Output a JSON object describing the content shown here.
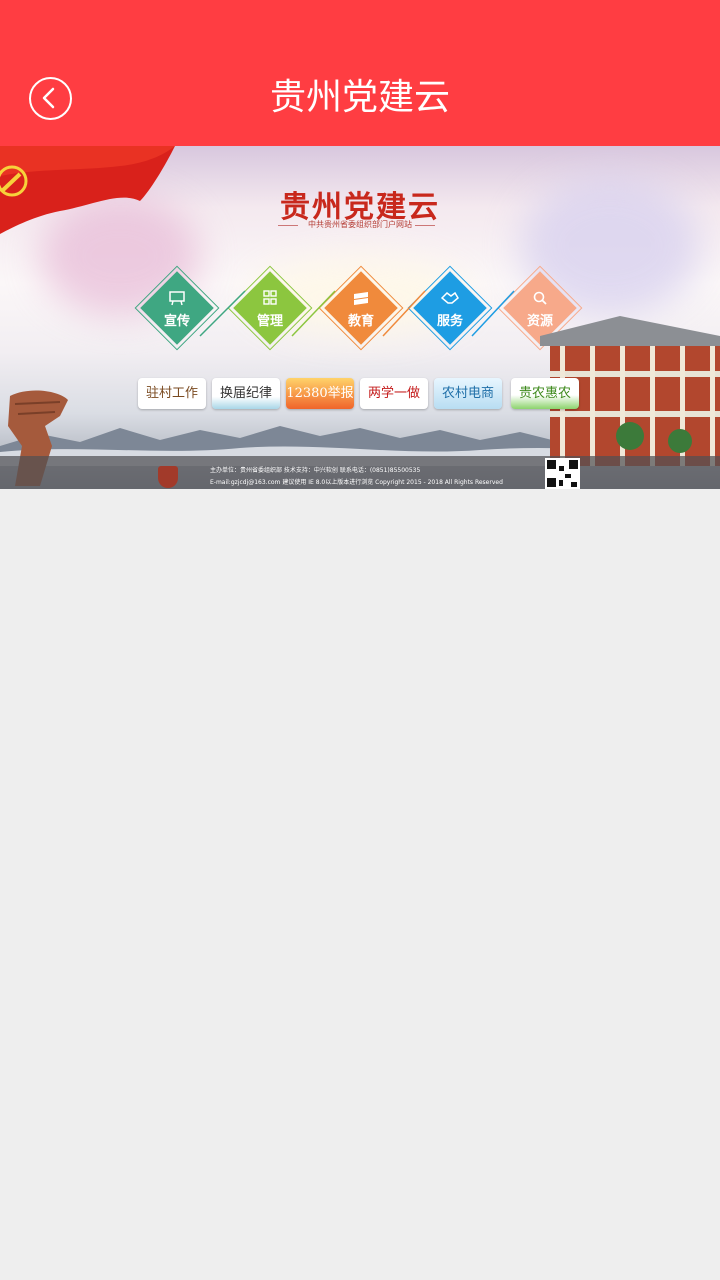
{
  "header": {
    "title": "贵州党建云",
    "back_icon": "back-arrow-icon"
  },
  "banner": {
    "title": "贵州党建云",
    "subtitle": "中共贵州省委组织部门户网站",
    "categories": [
      {
        "label": "宣传",
        "color": "#3fa782",
        "icon": "billboard-icon"
      },
      {
        "label": "管理",
        "color": "#8cc63f",
        "icon": "grid-icon"
      },
      {
        "label": "教育",
        "color": "#f08a3c",
        "icon": "books-icon"
      },
      {
        "label": "服务",
        "color": "#1e9de3",
        "icon": "handshake-icon"
      },
      {
        "label": "资源",
        "color": "#f7a98a",
        "icon": "search-icon"
      }
    ],
    "tiles": [
      {
        "label": "驻村工作"
      },
      {
        "label": "换届纪律"
      },
      {
        "label": "12380举报"
      },
      {
        "label": "两学一做"
      },
      {
        "label": "农村电商"
      },
      {
        "label": "贵农惠农"
      }
    ],
    "footer": {
      "line1": "主办单位：贵州省委组织部    技术支持：中兴软创    联系电话：(0851)85500535",
      "line2": "E-mail:gzjcdj@163.com    建议使用 IE 8.0以上版本进行浏览    Copyright 2015 - 2018    All Rights Reserved"
    }
  },
  "colors": {
    "header_bg": "#ff3d42",
    "page_bg": "#eeeeee"
  }
}
